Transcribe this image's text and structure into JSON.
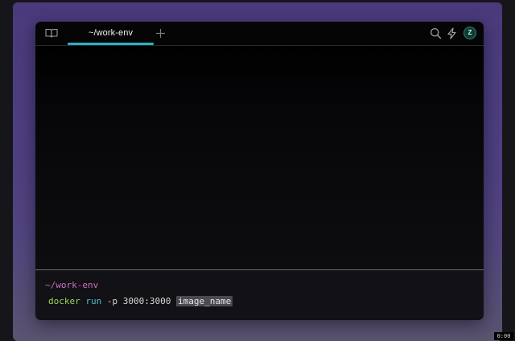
{
  "tabs": [
    {
      "label": "~/work-env",
      "active": true
    }
  ],
  "toolbar": {
    "sidebar_icon": "book-open-icon",
    "new_tab_icon": "plus-icon",
    "search_icon": "search-icon",
    "bolt_icon": "lightning-bolt-icon",
    "avatar_initial": "Z"
  },
  "terminal": {
    "prompt_path": "~/work-env",
    "command": {
      "program": "docker",
      "subcommand": "run",
      "args": " -p 3000:3000 ",
      "placeholder": "image_name"
    }
  },
  "video_timer": "0:00",
  "colors": {
    "accent": "#2bb0c2",
    "prompt": "#d16fc0",
    "command": "#9ad35a",
    "subcommand": "#57b9c8",
    "backdrop": "#4a3a7c"
  }
}
